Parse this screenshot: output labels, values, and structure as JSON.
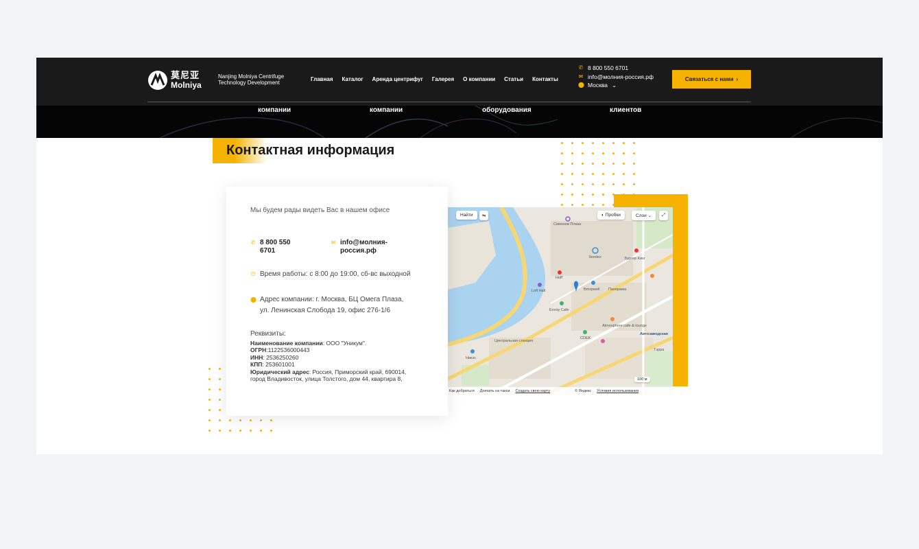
{
  "brand": {
    "logo_cn": "莫尼亚",
    "logo_en": "Molniya",
    "company_line1": "Nanjing Molniya Centrifuge",
    "company_line2": "Technology Development"
  },
  "nav": {
    "items": [
      "Главная",
      "Каталог",
      "Аренда центрифуг",
      "Галерея",
      "О компании",
      "Статьи",
      "Контакты"
    ]
  },
  "header_contacts": {
    "phone": "8 800 550 6701",
    "email": "info@молния-россия.рф",
    "city": "Москва"
  },
  "cta": {
    "label": "Связаться с нами",
    "arrow": "›"
  },
  "stats": [
    "компании",
    "компании",
    "оборудования",
    "клиентов"
  ],
  "section": {
    "title": "Контактная информация"
  },
  "card": {
    "intro": "Мы будем рады видеть Вас в нашем офисе",
    "phone_line1": "8 800 550",
    "phone_line2": "6701",
    "email_line1": "info@молния-",
    "email_line2": "россия.рф",
    "hours": "Время работы: с 8:00 до 19:00, сб-вс выходной",
    "address_line1": "Адрес компании: г. Москва, БЦ Омега Плаза,",
    "address_line2": "ул. Ленинская Слобода 19, офис 276-1/6",
    "requisites_title": "Реквизиты:",
    "company_name_label": "Наименование компании",
    "company_name_value": ": ООО \"Уникум\".",
    "ogrn_label": "ОГРН",
    "ogrn_value": ":1122536000443",
    "inn_label": "ИНН",
    "inn_value": ": 2536250260",
    "kpp_label": "КПП",
    "kpp_value": ": 253601001",
    "legal_label": "Юридический адрес",
    "legal_value": ": Россия, Приморский край, 690014, город Владивосток, улица Толстого, дом 44, квартира 8,"
  },
  "map": {
    "find_button": "Найти",
    "traffic_button": "Пробки",
    "layers_button": "Слои",
    "route_link": "Как добраться",
    "taxi_link": "Доехать на такси",
    "create_map_link": "Создать свою карту",
    "yandex_text": "© Яндекс",
    "terms_link": "Условия использования",
    "scale": "100 м",
    "labels": [
      "Симонов Плаза",
      "Ikontex",
      "Бургер Кинг",
      "Hoff",
      "Loft Hall",
      "Bmxpwell",
      "Панорама",
      "Envoy Cafe",
      "Центральная станция",
      "CDEK",
      "Atmosphere cafe & lounge",
      "Автозаводская",
      "Никэс",
      "Тэрра"
    ]
  },
  "colors": {
    "accent": "#f5b300",
    "header_bg": "#1a1a1a",
    "river": "#aad3f0"
  }
}
